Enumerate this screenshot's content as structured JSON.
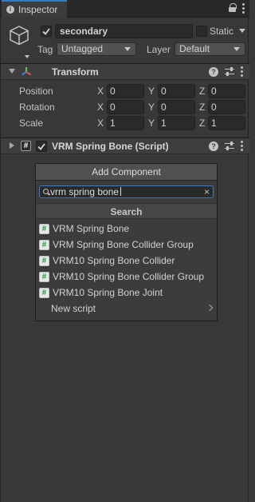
{
  "tab": {
    "title": "Inspector"
  },
  "header": {
    "name": "secondary",
    "static_label": "Static",
    "tag_label": "Tag",
    "tag_value": "Untagged",
    "layer_label": "Layer",
    "layer_value": "Default"
  },
  "transform": {
    "title": "Transform",
    "rows": [
      {
        "label": "Position",
        "x": "0",
        "y": "0",
        "z": "0"
      },
      {
        "label": "Rotation",
        "x": "0",
        "y": "0",
        "z": "0"
      },
      {
        "label": "Scale",
        "x": "1",
        "y": "1",
        "z": "1"
      }
    ],
    "axes": [
      "X",
      "Y",
      "Z"
    ]
  },
  "script_component": {
    "title": "VRM Spring Bone (Script)"
  },
  "add_component": {
    "title": "Add Component",
    "search_value": "vrm spring bone",
    "section": "Search",
    "items": [
      "VRM Spring Bone",
      "VRM Spring Bone Collider Group",
      "VRM10 Spring Bone Collider",
      "VRM10 Spring Bone Collider Group",
      "VRM10 Spring Bone Joint"
    ],
    "new_script": "New script"
  },
  "colors": {
    "accent": "#3a79bb",
    "panel": "#383838",
    "script_icon": "#1a9a3a"
  }
}
